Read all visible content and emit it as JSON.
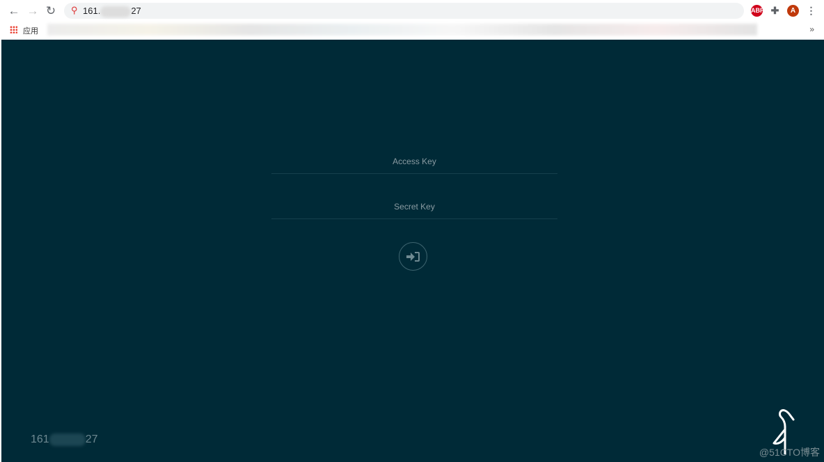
{
  "browser": {
    "url_prefix": "161.",
    "url_suffix": "27",
    "bookmarks_label": "应用",
    "profile_initial": "A",
    "abp_label": "ABP",
    "more_bookmarks": "»"
  },
  "login": {
    "access_key_placeholder": "Access Key",
    "secret_key_placeholder": "Secret Key",
    "submit_icon": "sign-in-icon"
  },
  "footer": {
    "host_prefix": "161",
    "host_suffix": "27"
  },
  "watermark": "@51CTO博客",
  "colors": {
    "background": "#002a37",
    "accent": "#c72e49"
  }
}
